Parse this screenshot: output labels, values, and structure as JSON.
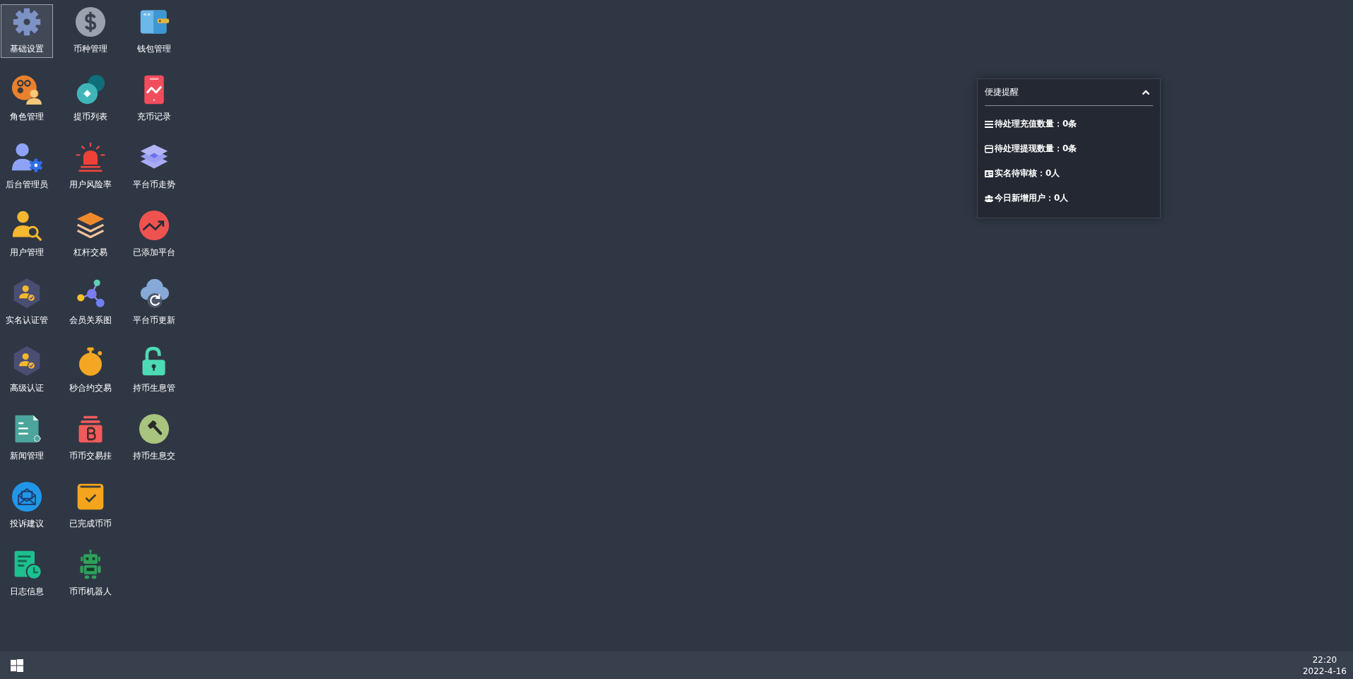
{
  "desktop_icons": [
    {
      "label": "基础设置",
      "selected": true
    },
    {
      "label": "角色管理",
      "selected": false
    },
    {
      "label": "后台管理员",
      "selected": false
    },
    {
      "label": "用户管理",
      "selected": false
    },
    {
      "label": "实名认证管",
      "selected": false
    },
    {
      "label": "高级认证",
      "selected": false
    },
    {
      "label": "新闻管理",
      "selected": false
    },
    {
      "label": "投诉建议",
      "selected": false
    },
    {
      "label": "日志信息",
      "selected": false
    },
    {
      "label": "币种管理",
      "selected": false
    },
    {
      "label": "提币列表",
      "selected": false
    },
    {
      "label": "用户风险率",
      "selected": false
    },
    {
      "label": "杠杆交易",
      "selected": false
    },
    {
      "label": "会员关系图",
      "selected": false
    },
    {
      "label": "秒合约交易",
      "selected": false
    },
    {
      "label": "币币交易挂",
      "selected": false
    },
    {
      "label": "已完成币币",
      "selected": false
    },
    {
      "label": "币币机器人",
      "selected": false
    },
    {
      "label": "钱包管理",
      "selected": false
    },
    {
      "label": "充币记录",
      "selected": false
    },
    {
      "label": "平台币走势",
      "selected": false
    },
    {
      "label": "已添加平台",
      "selected": false
    },
    {
      "label": "平台币更新",
      "selected": false
    },
    {
      "label": "持币生息管",
      "selected": false
    },
    {
      "label": "持币生息交",
      "selected": false
    }
  ],
  "reminder_panel": {
    "title": "便捷提醒",
    "expanded": true,
    "items": [
      "待处理充值数量：0条",
      "待处理提现数量：0条",
      "实名待审核：0人",
      "今日新增用户：0人"
    ]
  },
  "taskbar": {
    "time": "22:20",
    "date": "2022-4-16"
  }
}
